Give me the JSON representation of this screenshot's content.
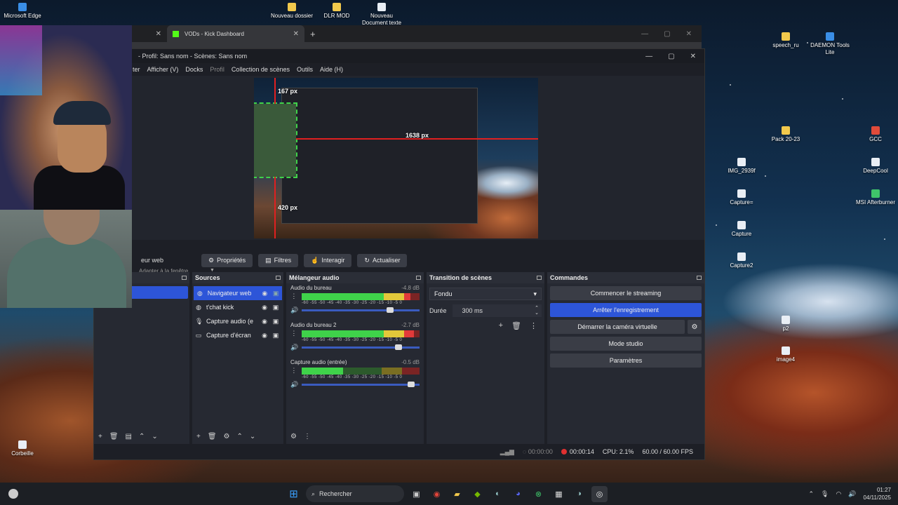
{
  "desktop": {
    "icons": {
      "edge": "Microsoft Edge",
      "nouveau_dossier": "Nouveau dossier",
      "dlr_mod": "DLR MOD",
      "nouveau_doc": "Nouveau\nDocument texte",
      "speech_ru": "speech_ru",
      "daemon": "DAEMON Tools\nLite",
      "pack": "Pack 20-23",
      "gcc": "GCC",
      "img": "IMG_2939f",
      "deepcool": "DeepCool",
      "capture_eq": "Capture=",
      "msi": "MSI Afterburner",
      "capture": "Capture",
      "capture2": "Capture2",
      "p2": "p2",
      "image4": "image4",
      "corbeille": "Corbeille"
    }
  },
  "browser": {
    "tab_title": "VODs - Kick Dashboard",
    "close_glyph": "✕",
    "new_tab": "+"
  },
  "obs": {
    "window_title": "- Profil: Sans nom - Scènes: Sans nom",
    "menu": {
      "filter": "ter",
      "view": "Afficher (V)",
      "docks": "Docks",
      "profile": "Profil",
      "scene_collection": "Collection de scènes",
      "tools": "Outils",
      "help": "Aide (H)"
    },
    "preview": {
      "top_px": "167 px",
      "right_px": "1638 px",
      "bottom_px": "420 px",
      "fit_label": "Adapter à la fenêtre"
    },
    "toolbar": {
      "source_label": "eur web",
      "properties": "Propriétés",
      "filters": "Filtres",
      "interact": "Interagir",
      "refresh": "Actualiser"
    },
    "sources": {
      "header": "Sources",
      "items": [
        {
          "name": "Navigateur web"
        },
        {
          "name": "t'chat kick"
        },
        {
          "name": "Capture audio (e"
        },
        {
          "name": "Capture d'écran"
        }
      ]
    },
    "mixer": {
      "header": "Mélangeur audio",
      "scale": "-60 -55 -50 -45 -40 -35 -30 -25 -20 -15 -10 -5 0",
      "channels": [
        {
          "name": "Audio du bureau",
          "db": "-4.8 dB",
          "level": 0.92,
          "fader": 0.75
        },
        {
          "name": "Audio du bureau 2",
          "db": "-2.7 dB",
          "level": 0.95,
          "fader": 0.82
        },
        {
          "name": "Capture audio (entrée)",
          "db": "-0.5 dB",
          "level": 0.35,
          "fader": 0.93
        }
      ]
    },
    "transition": {
      "header": "Transition de scènes",
      "type": "Fondu",
      "duration_label": "Durée",
      "duration_value": "300 ms"
    },
    "commands": {
      "header": "Commandes",
      "start_stream": "Commencer le streaming",
      "stop_record": "Arrêter l'enregistrement",
      "virtual_cam": "Démarrer la caméra virtuelle",
      "studio_mode": "Mode studio",
      "settings": "Paramètres"
    },
    "status": {
      "stream_time": "00:00:00",
      "rec_time": "00:00:14",
      "cpu": "CPU: 2.1%",
      "fps": "60.00 / 60.00 FPS"
    }
  },
  "taskbar": {
    "search": "Rechercher",
    "time": "01:27",
    "date": "04/11/2025"
  },
  "colors": {
    "accent_blue": "#2d55d8",
    "rec_red": "#e03030",
    "meter_green": "#3fd24a"
  }
}
